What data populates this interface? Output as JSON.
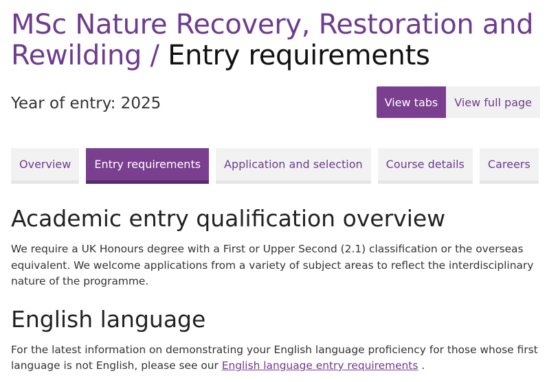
{
  "header": {
    "course_title": "MSc Nature Recovery, Restoration and Rewilding",
    "separator": "/",
    "section_title": "Entry requirements"
  },
  "year_of_entry": "Year of entry: 2025",
  "view_toggle": {
    "view_tabs": "View tabs",
    "view_full_page": "View full page"
  },
  "tabs": [
    {
      "label": "Overview",
      "active": false
    },
    {
      "label": "Entry requirements",
      "active": true
    },
    {
      "label": "Application and selection",
      "active": false
    },
    {
      "label": "Course details",
      "active": false
    },
    {
      "label": "Careers",
      "active": false
    }
  ],
  "academic": {
    "heading": "Academic entry qualification overview",
    "body": "We require a UK Honours degree with a First or Upper Second (2.1) classification or the overseas equivalent. We welcome applications from a variety of subject areas to reflect the interdisciplinary nature of the programme."
  },
  "english": {
    "heading": "English language",
    "body_prefix": "For the latest information on demonstrating your English language proficiency for those whose first language is not English, please see our",
    "link_text": "English language entry requirements",
    "body_suffix": "."
  },
  "colors": {
    "brand_purple": "#7a3f8f",
    "link_purple": "#6e3b8f",
    "tab_background": "#f2f2f2"
  }
}
